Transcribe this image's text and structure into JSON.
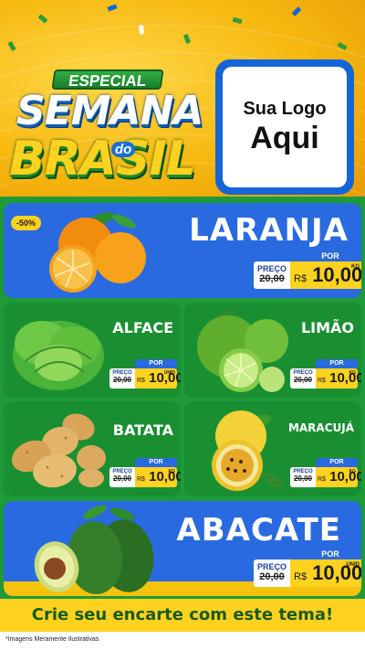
{
  "header": {
    "special_label": "ESPECIAL",
    "title_line1": "SEMANA",
    "title_do": "do",
    "title_line2": "BRASIL",
    "logo_line1": "Sua Logo",
    "logo_line2": "Aqui"
  },
  "colors": {
    "header_yellow": "#f6b80e",
    "green_bg": "#1f9a39",
    "blue_card": "#2a6ae0",
    "price_yellow": "#ffd21f"
  },
  "products": [
    {
      "name": "LARANJA",
      "por": "POR",
      "preco_label": "PREÇO",
      "old_prefix": "R$",
      "old_price": "20,00",
      "currency": "R$",
      "price": "10,00",
      "unit": "KG",
      "badge": "-50%"
    },
    {
      "name": "ALFACE",
      "por": "POR",
      "preco_label": "PREÇO",
      "old_prefix": "R$",
      "old_price": "20,00",
      "currency": "R$",
      "price": "10,00",
      "unit": "UNID"
    },
    {
      "name": "LIMÃO",
      "por": "POR",
      "preco_label": "PREÇO",
      "old_prefix": "R$",
      "old_price": "20,00",
      "currency": "R$",
      "price": "10,00",
      "unit": "KG"
    },
    {
      "name": "BATATA",
      "por": "POR",
      "preco_label": "PREÇO",
      "old_prefix": "R$",
      "old_price": "20,00",
      "currency": "R$",
      "price": "10,00",
      "unit": "KG"
    },
    {
      "name": "MARACUJÁ",
      "por": "POR",
      "preco_label": "PREÇO",
      "old_prefix": "R$",
      "old_price": "20,00",
      "currency": "R$",
      "price": "10,00",
      "unit": "KG"
    },
    {
      "name": "ABACATE",
      "por": "POR",
      "preco_label": "PREÇO",
      "old_prefix": "R$",
      "old_price": "20,00",
      "currency": "R$",
      "price": "10,00",
      "unit": "UNID"
    }
  ],
  "cta": "Crie seu encarte com este tema!",
  "footer_note": "*Imagens Meramente Ilustrativas"
}
